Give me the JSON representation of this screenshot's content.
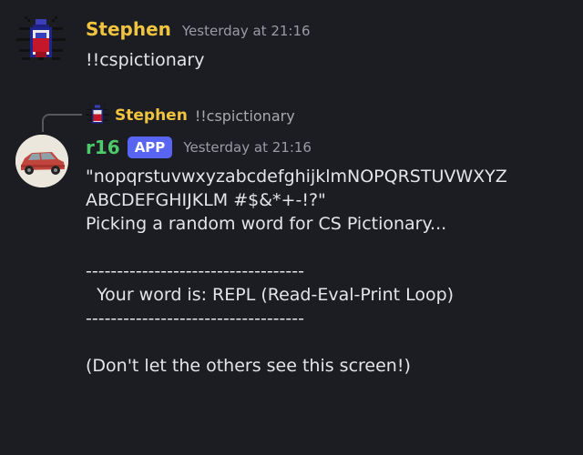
{
  "messages": [
    {
      "author": "Stephen",
      "author_color": "#f0c43f",
      "timestamp": "Yesterday at 21:16",
      "avatar_icon": "pixel-bug-icon",
      "content": "!!cspictionary"
    },
    {
      "author": "r16",
      "author_color": "#4ec96a",
      "badge": "APP",
      "badge_color": "#5865f2",
      "timestamp": "Yesterday at 21:16",
      "avatar_icon": "red-car-icon",
      "reply": {
        "author": "Stephen",
        "content": "!!cspictionary",
        "avatar_icon": "pixel-bug-icon"
      },
      "content_lines": [
        "\"nopqrstuvwxyzabcdefghijklmNOPQRSTUVWXYZ",
        "ABCDEFGHIJKLM #$&*+-!?\"",
        "Picking a random word for CS Pictionary...",
        "",
        "-----------------------------------",
        "  Your word is: REPL (Read-Eval-Print Loop)",
        "-----------------------------------",
        "",
        "(Don't let the others see this screen!)"
      ]
    }
  ]
}
